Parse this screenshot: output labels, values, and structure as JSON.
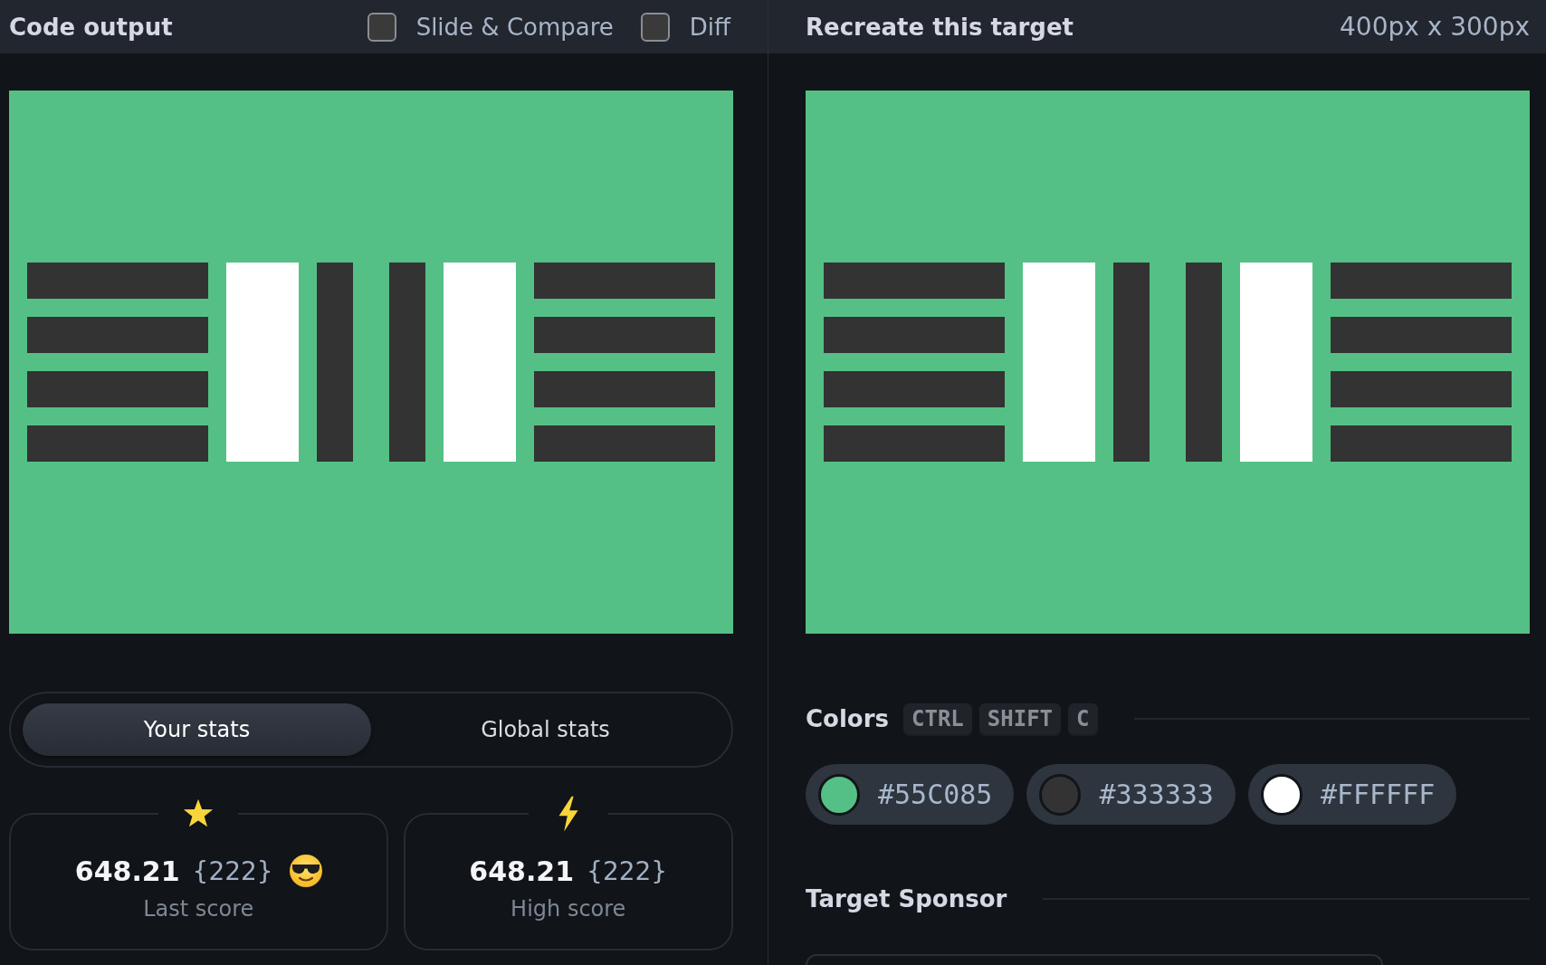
{
  "output_panel": {
    "title": "Code output",
    "options": [
      {
        "label": "Slide & Compare",
        "checked": false
      },
      {
        "label": "Diff",
        "checked": false
      }
    ],
    "stats_tabs": [
      {
        "label": "Your stats",
        "selected": true
      },
      {
        "label": "Global stats",
        "selected": false
      }
    ],
    "stat_cards": [
      {
        "kind": "last",
        "score": "648.21",
        "count": "{222}",
        "label": "Last score"
      },
      {
        "kind": "high",
        "score": "648.21",
        "count": "{222}",
        "label": "High score"
      }
    ]
  },
  "target_panel": {
    "title": "Recreate this target",
    "size": "400px x 300px",
    "colors": {
      "title": "Colors",
      "shortcut": [
        "CTRL",
        "SHIFT",
        "C"
      ],
      "swatches": [
        {
          "color": "#55c085",
          "code": "#55C085"
        },
        {
          "color": "#333333",
          "code": "#333333"
        },
        {
          "color": "#ffffff",
          "code": "#FFFFFF"
        }
      ]
    },
    "sponsor": {
      "title": "Target Sponsor"
    }
  }
}
